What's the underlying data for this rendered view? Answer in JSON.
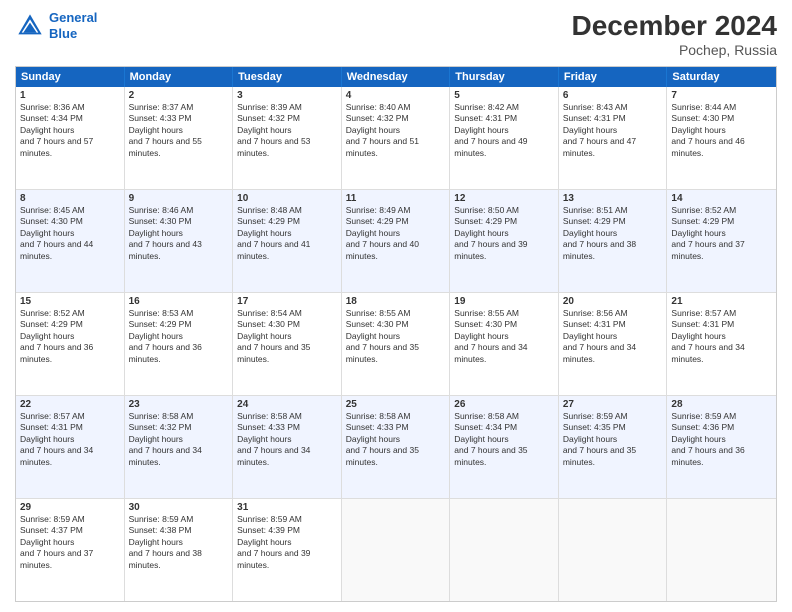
{
  "header": {
    "logo_line1": "General",
    "logo_line2": "Blue",
    "title": "December 2024",
    "subtitle": "Pochep, Russia"
  },
  "days": [
    "Sunday",
    "Monday",
    "Tuesday",
    "Wednesday",
    "Thursday",
    "Friday",
    "Saturday"
  ],
  "rows": [
    [
      {
        "day": "1",
        "rise": "8:36 AM",
        "set": "4:34 PM",
        "hours": "7 hours and 57 minutes."
      },
      {
        "day": "2",
        "rise": "8:37 AM",
        "set": "4:33 PM",
        "hours": "7 hours and 55 minutes."
      },
      {
        "day": "3",
        "rise": "8:39 AM",
        "set": "4:32 PM",
        "hours": "7 hours and 53 minutes."
      },
      {
        "day": "4",
        "rise": "8:40 AM",
        "set": "4:32 PM",
        "hours": "7 hours and 51 minutes."
      },
      {
        "day": "5",
        "rise": "8:42 AM",
        "set": "4:31 PM",
        "hours": "7 hours and 49 minutes."
      },
      {
        "day": "6",
        "rise": "8:43 AM",
        "set": "4:31 PM",
        "hours": "7 hours and 47 minutes."
      },
      {
        "day": "7",
        "rise": "8:44 AM",
        "set": "4:30 PM",
        "hours": "7 hours and 46 minutes."
      }
    ],
    [
      {
        "day": "8",
        "rise": "8:45 AM",
        "set": "4:30 PM",
        "hours": "7 hours and 44 minutes."
      },
      {
        "day": "9",
        "rise": "8:46 AM",
        "set": "4:30 PM",
        "hours": "7 hours and 43 minutes."
      },
      {
        "day": "10",
        "rise": "8:48 AM",
        "set": "4:29 PM",
        "hours": "7 hours and 41 minutes."
      },
      {
        "day": "11",
        "rise": "8:49 AM",
        "set": "4:29 PM",
        "hours": "7 hours and 40 minutes."
      },
      {
        "day": "12",
        "rise": "8:50 AM",
        "set": "4:29 PM",
        "hours": "7 hours and 39 minutes."
      },
      {
        "day": "13",
        "rise": "8:51 AM",
        "set": "4:29 PM",
        "hours": "7 hours and 38 minutes."
      },
      {
        "day": "14",
        "rise": "8:52 AM",
        "set": "4:29 PM",
        "hours": "7 hours and 37 minutes."
      }
    ],
    [
      {
        "day": "15",
        "rise": "8:52 AM",
        "set": "4:29 PM",
        "hours": "7 hours and 36 minutes."
      },
      {
        "day": "16",
        "rise": "8:53 AM",
        "set": "4:29 PM",
        "hours": "7 hours and 36 minutes."
      },
      {
        "day": "17",
        "rise": "8:54 AM",
        "set": "4:30 PM",
        "hours": "7 hours and 35 minutes."
      },
      {
        "day": "18",
        "rise": "8:55 AM",
        "set": "4:30 PM",
        "hours": "7 hours and 35 minutes."
      },
      {
        "day": "19",
        "rise": "8:55 AM",
        "set": "4:30 PM",
        "hours": "7 hours and 34 minutes."
      },
      {
        "day": "20",
        "rise": "8:56 AM",
        "set": "4:31 PM",
        "hours": "7 hours and 34 minutes."
      },
      {
        "day": "21",
        "rise": "8:57 AM",
        "set": "4:31 PM",
        "hours": "7 hours and 34 minutes."
      }
    ],
    [
      {
        "day": "22",
        "rise": "8:57 AM",
        "set": "4:31 PM",
        "hours": "7 hours and 34 minutes."
      },
      {
        "day": "23",
        "rise": "8:58 AM",
        "set": "4:32 PM",
        "hours": "7 hours and 34 minutes."
      },
      {
        "day": "24",
        "rise": "8:58 AM",
        "set": "4:33 PM",
        "hours": "7 hours and 34 minutes."
      },
      {
        "day": "25",
        "rise": "8:58 AM",
        "set": "4:33 PM",
        "hours": "7 hours and 35 minutes."
      },
      {
        "day": "26",
        "rise": "8:58 AM",
        "set": "4:34 PM",
        "hours": "7 hours and 35 minutes."
      },
      {
        "day": "27",
        "rise": "8:59 AM",
        "set": "4:35 PM",
        "hours": "7 hours and 35 minutes."
      },
      {
        "day": "28",
        "rise": "8:59 AM",
        "set": "4:36 PM",
        "hours": "7 hours and 36 minutes."
      }
    ],
    [
      {
        "day": "29",
        "rise": "8:59 AM",
        "set": "4:37 PM",
        "hours": "7 hours and 37 minutes."
      },
      {
        "day": "30",
        "rise": "8:59 AM",
        "set": "4:38 PM",
        "hours": "7 hours and 38 minutes."
      },
      {
        "day": "31",
        "rise": "8:59 AM",
        "set": "4:39 PM",
        "hours": "7 hours and 39 minutes."
      },
      null,
      null,
      null,
      null
    ]
  ]
}
